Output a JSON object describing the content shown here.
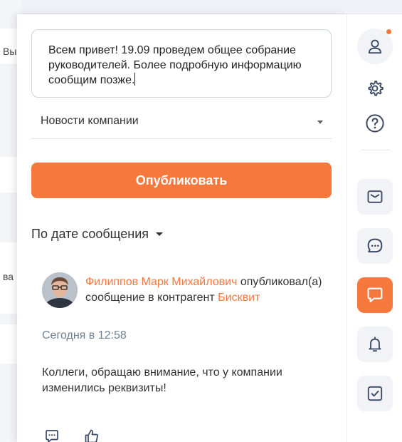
{
  "background": {
    "snippet_1": "Вы",
    "snippet_2": "ва"
  },
  "composer": {
    "text": "Всем привет! 19.09 проведем общее собрание руководителей. Более подробную информацию сообщим позже."
  },
  "category_select": {
    "value": "Новости компании"
  },
  "publish_button": {
    "label": "Опубликовать"
  },
  "sort": {
    "label": "По дате сообщения"
  },
  "post": {
    "author": "Филиппов Марк Михайлович",
    "action": "опубликовал(а) сообщение в контрагент",
    "target": "Бисквит",
    "time": "Сегодня в 12:58",
    "body": "Коллеги, обращаю внимание, что у компании изменились реквизиты!"
  },
  "rail": {
    "items": [
      "user-icon",
      "gear-icon",
      "help-icon",
      "mail-icon",
      "chat-icon",
      "message-icon",
      "bell-icon",
      "checkbox-icon"
    ],
    "active": "message-icon"
  },
  "colors": {
    "accent": "#f7783c",
    "muted": "#6f7f96",
    "icon": "#3b4a63"
  }
}
